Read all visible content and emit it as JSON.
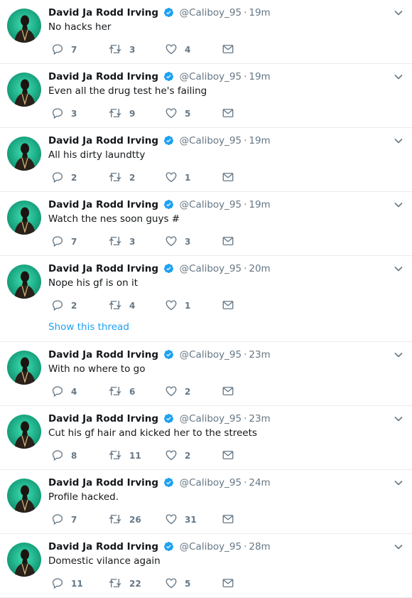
{
  "colors": {
    "accent": "#1da1f2",
    "muted": "#657786",
    "divider": "#e6ecf0",
    "avatar_bg": "#1bb98e"
  },
  "icons": {
    "reply": "reply-icon",
    "retweet": "retweet-icon",
    "like": "heart-icon",
    "dm": "envelope-icon",
    "verified": "verified-badge-icon",
    "more": "chevron-down-icon"
  },
  "tweets": [
    {
      "name": "David Ja Rodd Irving",
      "handle": "@Caliboy_95",
      "sep": "·",
      "time": "19m",
      "text": "No hacks her",
      "replies": "7",
      "retweets": "3",
      "likes": "4"
    },
    {
      "name": "David Ja Rodd Irving",
      "handle": "@Caliboy_95",
      "sep": "·",
      "time": "19m",
      "text": "Even all the drug test he's failing",
      "replies": "3",
      "retweets": "9",
      "likes": "5"
    },
    {
      "name": "David Ja Rodd Irving",
      "handle": "@Caliboy_95",
      "sep": "·",
      "time": "19m",
      "text": "All his dirty laundtty",
      "replies": "2",
      "retweets": "2",
      "likes": "1"
    },
    {
      "name": "David Ja Rodd Irving",
      "handle": "@Caliboy_95",
      "sep": "·",
      "time": "19m",
      "text": "Watch the nes soon guys #",
      "replies": "7",
      "retweets": "3",
      "likes": "3"
    },
    {
      "name": "David Ja Rodd Irving",
      "handle": "@Caliboy_95",
      "sep": "·",
      "time": "20m",
      "text": "Nope his gf is on it",
      "replies": "2",
      "retweets": "4",
      "likes": "1",
      "thread_link": "Show this thread"
    },
    {
      "name": "David Ja Rodd Irving",
      "handle": "@Caliboy_95",
      "sep": "·",
      "time": "23m",
      "text": "With no where to go",
      "replies": "4",
      "retweets": "6",
      "likes": "2"
    },
    {
      "name": "David Ja Rodd Irving",
      "handle": "@Caliboy_95",
      "sep": "·",
      "time": "23m",
      "text": "Cut his gf hair and kicked her to the streets",
      "replies": "8",
      "retweets": "11",
      "likes": "2"
    },
    {
      "name": "David Ja Rodd Irving",
      "handle": "@Caliboy_95",
      "sep": "·",
      "time": "24m",
      "text": "Profile hacked.",
      "replies": "7",
      "retweets": "26",
      "likes": "31"
    },
    {
      "name": "David Ja Rodd Irving",
      "handle": "@Caliboy_95",
      "sep": "·",
      "time": "28m",
      "text": "Domestic vilance again",
      "replies": "11",
      "retweets": "22",
      "likes": "5"
    }
  ]
}
